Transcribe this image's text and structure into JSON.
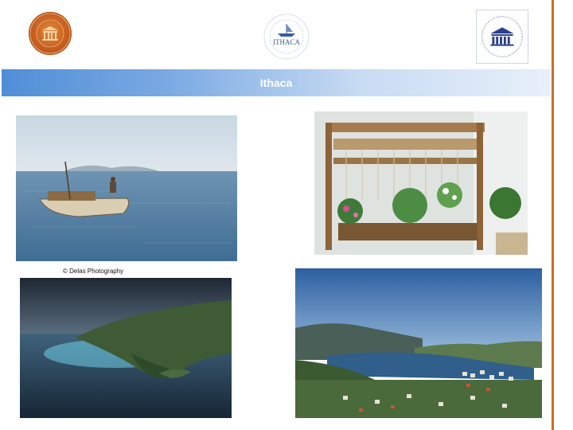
{
  "slide": {
    "title": "Ithaca",
    "photo_credit": "© Delas Photography"
  },
  "logos": {
    "left": {
      "icon": "society-seal-icon",
      "color": "#c45a1c"
    },
    "middle": {
      "icon": "journey-to-ithaca-logo-icon",
      "word": "ITHACA",
      "color": "#3a5f96"
    },
    "right": {
      "icon": "unesco-logo-icon",
      "color": "#2b3f8c"
    }
  },
  "colors": {
    "accent_band": "#4f8ed7",
    "right_rule": "#c8702a"
  }
}
